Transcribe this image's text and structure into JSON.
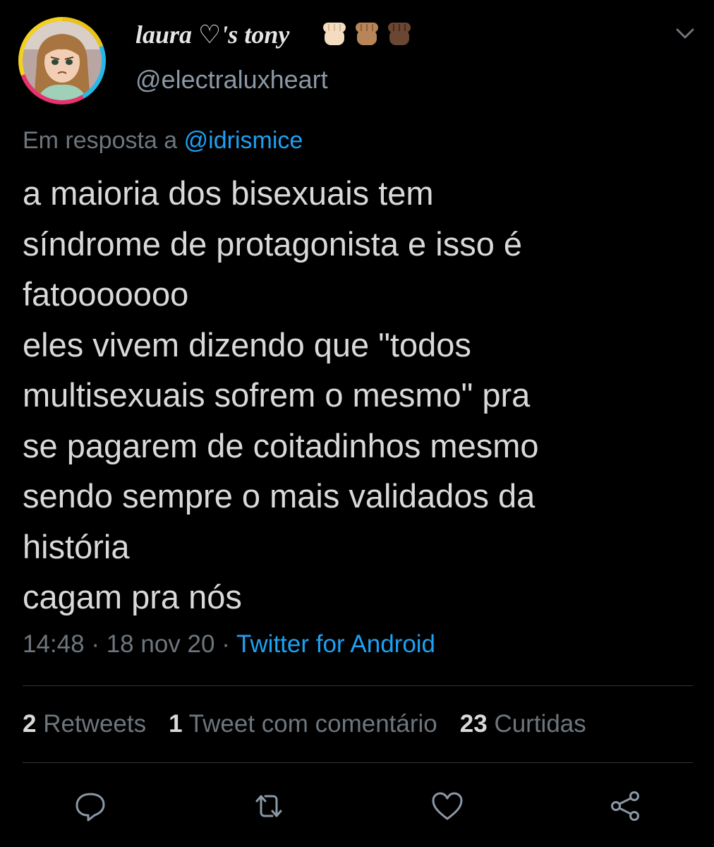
{
  "author": {
    "display_name": "laura ♡'s tony",
    "handle": "@electraluxheart",
    "avatar_icon": "cartoon-avatar",
    "emoji": [
      "raised-fist-light",
      "raised-fist-medium",
      "raised-fist-dark"
    ]
  },
  "reply": {
    "prefix": "Em resposta a",
    "mention": "@idrismice"
  },
  "tweet": {
    "lines": [
      "a maioria dos bisexuais tem",
      "síndrome de protagonista e isso é",
      "fatooooooo",
      "eles vivem dizendo que \"todos",
      "multisexuais sofrem o mesmo\" pra",
      "se pagarem de coitadinhos mesmo",
      "sendo sempre o mais validados da",
      "história",
      "cagam pra nós"
    ]
  },
  "meta": {
    "time": "14:48",
    "sep1": "·",
    "date": "18 nov 20",
    "sep2": "·",
    "source": "Twitter for Android"
  },
  "stats": {
    "retweets_count": "2",
    "retweets_label": "Retweets",
    "quotes_count": "1",
    "quotes_label": "Tweet com comentário",
    "likes_count": "23",
    "likes_label": "Curtidas"
  },
  "actions": [
    "reply-icon",
    "retweet-icon",
    "like-icon",
    "share-icon"
  ],
  "colors": {
    "background": "#000000",
    "text": "#d9d9d9",
    "muted": "#6e767d",
    "link": "#1da1f2",
    "divider": "#2f3336"
  }
}
